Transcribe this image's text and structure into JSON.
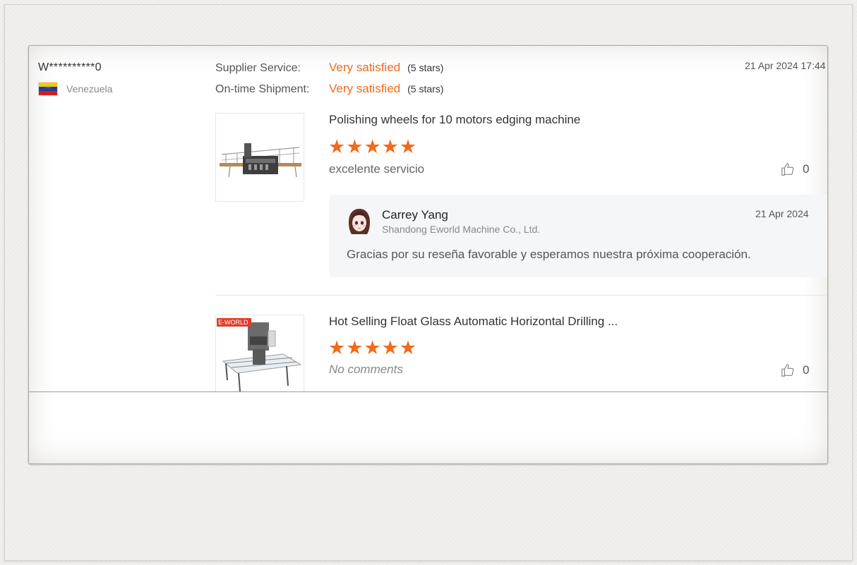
{
  "review": {
    "user_name": "W**********0",
    "country": "Venezuela",
    "date": "21 Apr 2024 17:44",
    "ratings": [
      {
        "label": "Supplier Service:",
        "value": "Very satisfied",
        "stars_text": "(5 stars)"
      },
      {
        "label": "On-time Shipment:",
        "value": "Very satisfied",
        "stars_text": "(5 stars)"
      }
    ],
    "products": [
      {
        "title": "Polishing wheels for 10 motors edging machine",
        "stars": 5,
        "comment": "excelente servicio",
        "likes": "0",
        "reply": {
          "name": "Carrey Yang",
          "company": "Shandong Eworld Machine Co., Ltd.",
          "date": "21 Apr 2024",
          "text": "Gracias por su reseña favorable y esperamos nuestra próxima cooperación."
        }
      },
      {
        "title": "Hot Selling Float Glass Automatic Horizontal Drilling ...",
        "stars": 5,
        "comment": "No comments",
        "likes": "0",
        "brand_tag": "E-WORLD"
      }
    ]
  },
  "colors": {
    "accent": "#f26a1b",
    "reply_bg": "#f5f6f7",
    "card_bg": "#ffffff"
  },
  "icons": [
    "flag-venezuela-icon",
    "star-icon",
    "thumbs-up-icon",
    "avatar-icon"
  ]
}
